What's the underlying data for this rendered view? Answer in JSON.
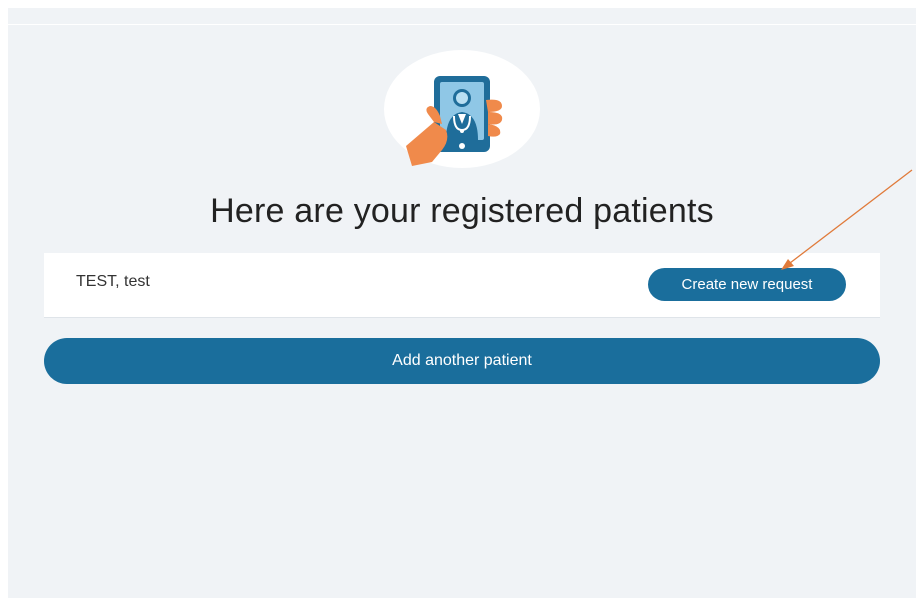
{
  "page": {
    "title": "Here are your registered patients"
  },
  "patients": [
    {
      "name": "TEST, test",
      "action_label": "Create new request"
    }
  ],
  "actions": {
    "add_patient_label": "Add another patient"
  },
  "colors": {
    "primary_button": "#1a6e9c",
    "background": "#f0f3f6",
    "annotation_arrow": "#e07a3a",
    "illustration_hand": "#f08a4b",
    "illustration_phone": "#1f6d9a"
  },
  "icons": {
    "hero": "hand-holding-phone-doctor-icon"
  }
}
